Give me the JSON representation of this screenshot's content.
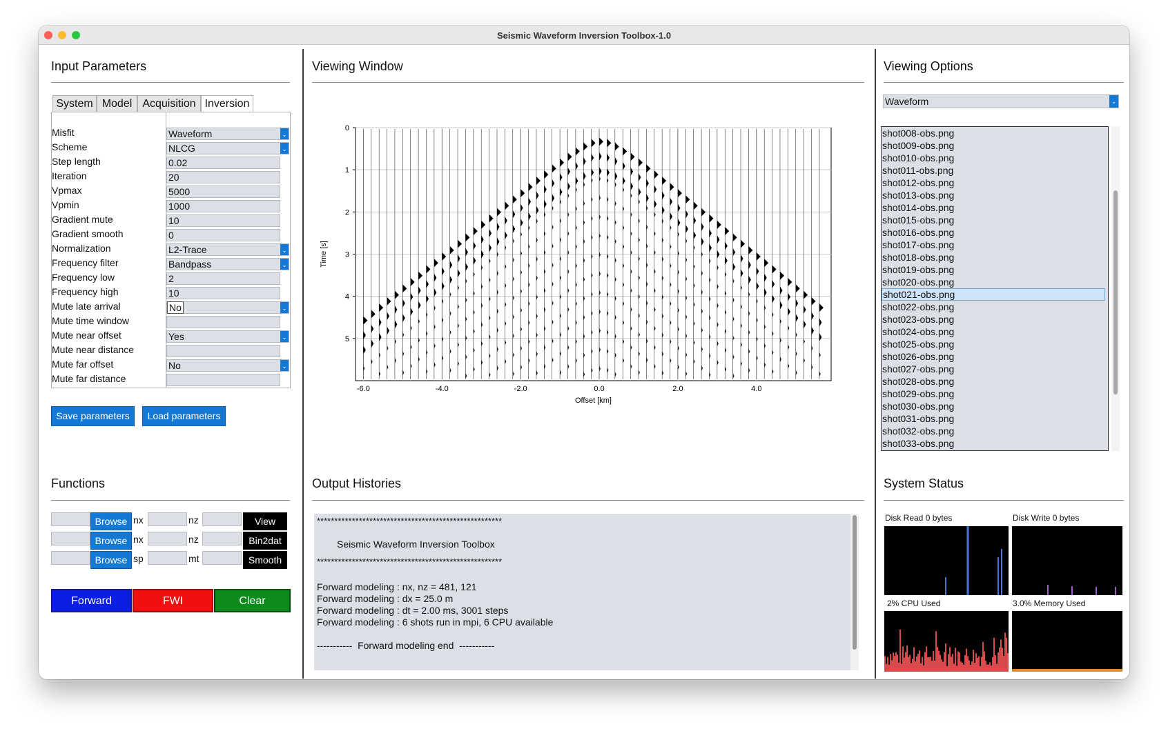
{
  "window": {
    "title": "Seismic Waveform Inversion Toolbox-1.0"
  },
  "panels": {
    "input": "Input Parameters",
    "viewing": "Viewing Window",
    "options": "Viewing Options",
    "functions": "Functions",
    "output": "Output Histories",
    "status": "System Status"
  },
  "tabs": [
    "System",
    "Model",
    "Acquisition",
    "Inversion"
  ],
  "params": [
    {
      "label": "Misfit",
      "value": "Waveform",
      "dropdown": true
    },
    {
      "label": "Scheme",
      "value": "NLCG",
      "dropdown": true
    },
    {
      "label": "Step length",
      "value": "0.02",
      "dropdown": false
    },
    {
      "label": "Iteration",
      "value": "20",
      "dropdown": false
    },
    {
      "label": "Vpmax",
      "value": "5000",
      "dropdown": false
    },
    {
      "label": "Vpmin",
      "value": "1000",
      "dropdown": false
    },
    {
      "label": "Gradient mute",
      "value": "10",
      "dropdown": false
    },
    {
      "label": "Gradient smooth",
      "value": "0",
      "dropdown": false
    },
    {
      "label": "Normalization",
      "value": "L2-Trace",
      "dropdown": true
    },
    {
      "label": "Frequency filter",
      "value": "Bandpass",
      "dropdown": true
    },
    {
      "label": "Frequency low",
      "value": "2",
      "dropdown": false
    },
    {
      "label": "Frequency high",
      "value": "10",
      "dropdown": false
    },
    {
      "label": "Mute late arrival",
      "value": "No",
      "dropdown": true
    },
    {
      "label": "Mute time window",
      "value": "",
      "dropdown": false
    },
    {
      "label": "Mute near offset",
      "value": "Yes",
      "dropdown": true
    },
    {
      "label": "Mute near distance",
      "value": "",
      "dropdown": false
    },
    {
      "label": "Mute far offset",
      "value": "No",
      "dropdown": true
    },
    {
      "label": "Mute far distance",
      "value": "",
      "dropdown": false
    }
  ],
  "buttons": {
    "save": "Save parameters",
    "load": "Load parameters",
    "forward": "Forward",
    "fwi": "FWI",
    "clear": "Clear"
  },
  "functions": [
    {
      "browse": "Browse",
      "l1": "nx",
      "l2": "nz",
      "action": "View"
    },
    {
      "browse": "Browse",
      "l1": "nx",
      "l2": "nz",
      "action": "Bin2dat"
    },
    {
      "browse": "Browse",
      "l1": "sp",
      "l2": "mt",
      "action": "Smooth"
    }
  ],
  "options": {
    "selected": "Waveform",
    "files": [
      "shot008-obs.png",
      "shot009-obs.png",
      "shot010-obs.png",
      "shot011-obs.png",
      "shot012-obs.png",
      "shot013-obs.png",
      "shot014-obs.png",
      "shot015-obs.png",
      "shot016-obs.png",
      "shot017-obs.png",
      "shot018-obs.png",
      "shot019-obs.png",
      "shot020-obs.png",
      "shot021-obs.png",
      "shot022-obs.png",
      "shot023-obs.png",
      "shot024-obs.png",
      "shot025-obs.png",
      "shot026-obs.png",
      "shot027-obs.png",
      "shot028-obs.png",
      "shot029-obs.png",
      "shot030-obs.png",
      "shot031-obs.png",
      "shot032-obs.png",
      "shot033-obs.png"
    ],
    "selected_file": "shot021-obs.png"
  },
  "output": {
    "stars": "*****************************************************",
    "header": "Seismic Waveform Inversion Toolbox",
    "lines": [
      "Forward modeling : nx, nz = 481, 121",
      "Forward modeling : dx = 25.0 m",
      "Forward modeling : dt = 2.00 ms, 3001 steps",
      "Forward modeling : 6 shots run in mpi, 6 CPU available"
    ],
    "end": "-----------  Forward modeling end  -----------"
  },
  "status": {
    "disk_read": "Disk Read 0 bytes",
    "disk_write": "Disk Write 0 bytes",
    "cpu": "2% CPU Used",
    "memory": "3.0% Memory Used"
  },
  "chart_data": {
    "type": "scatter",
    "title": "",
    "xlabel": "Offset [km]",
    "ylabel": "Time [s]",
    "xlim": [
      -6.2,
      5.9
    ],
    "ylim": [
      6.0,
      0
    ],
    "xticks": [
      "-6.0",
      "-4.0",
      "-2.0",
      "0.0",
      "2.0",
      "4.0"
    ],
    "xtick_values": [
      -6.0,
      -4.0,
      -2.0,
      0.0,
      2.0,
      4.0
    ],
    "yticks": [
      "0",
      "1",
      "2",
      "3",
      "4",
      "5"
    ],
    "ytick_values": [
      0,
      1,
      2,
      3,
      4,
      5
    ],
    "grid": true,
    "description_series": {
      "name": "",
      "source_offset": 0.0,
      "first_arrival_apex_time": 0.35,
      "traces_from": -6.0,
      "traces_to": 5.6,
      "trace_spacing": 0.2
    }
  },
  "colors": {
    "accent": "#1479d4",
    "forward": "#0a1ee6",
    "fwi": "#f01010",
    "clear": "#0c8a1c",
    "cpu": "#d94a4a",
    "disk": "#4a78d8"
  }
}
